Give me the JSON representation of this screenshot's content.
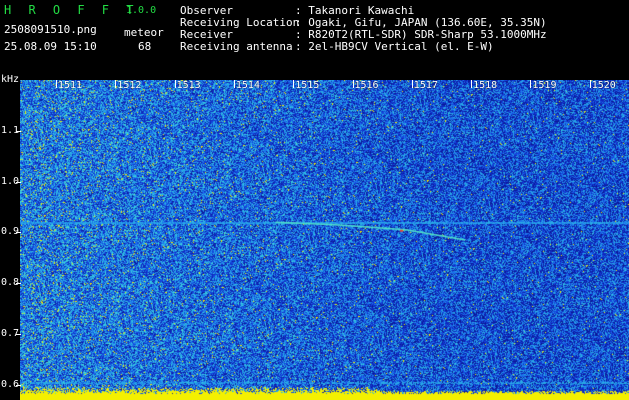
{
  "app": {
    "title": "H R O F F T",
    "version": "1.0.0",
    "filename": "2508091510.png",
    "datetime": "25.08.09 15:10",
    "mode_label": "meteor",
    "count": "68"
  },
  "info": [
    {
      "label": "Observer",
      "value": ": Takanori Kawachi"
    },
    {
      "label": "Receiving Location",
      "value": ": Ogaki, Gifu, JAPAN (136.60E, 35.35N)"
    },
    {
      "label": "Receiver",
      "value": ": R820T2(RTL-SDR) SDR-Sharp 53.1000MHz"
    },
    {
      "label": "Receiving antenna",
      "value": ": 2el-HB9CV Vertical (el. E-W)"
    }
  ],
  "colors": {
    "background": "#000000",
    "spectrum_base": "#0a1f9a",
    "text": "#ffffff",
    "accent_green": "#22dd44",
    "signal_yellow": "#f4f000"
  },
  "chart_data": {
    "type": "heatmap",
    "y_unit": "kHz",
    "y_ticks": [
      "1.1",
      "1.0",
      "0.9",
      "0.8",
      "0.7",
      "0.6"
    ],
    "x_ticks": [
      "1511",
      "1512",
      "1513",
      "1514",
      "1515",
      "1516",
      "1517",
      "1518",
      "1519",
      "1520"
    ],
    "ylim": [
      0.57,
      1.2
    ],
    "carrier_khz": 0.92,
    "meteor_trail": [
      {
        "time": 1514.6,
        "khz": 0.92
      },
      {
        "time": 1515.6,
        "khz": 0.915
      },
      {
        "time": 1516.8,
        "khz": 0.905
      },
      {
        "time": 1517.8,
        "khz": 0.885
      }
    ]
  }
}
